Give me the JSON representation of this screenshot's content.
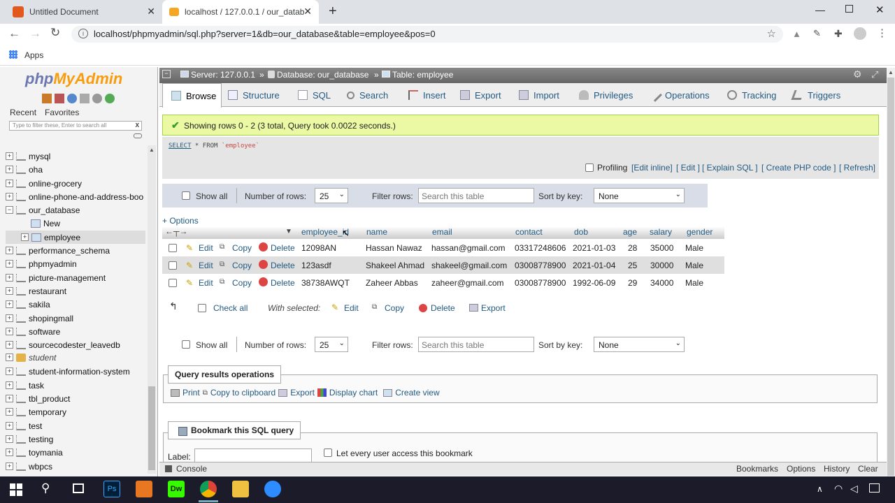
{
  "browser": {
    "tabs": [
      {
        "title": "Untitled Document"
      },
      {
        "title": "localhost / 127.0.0.1 / our_datab"
      }
    ],
    "url": "localhost/phpmyadmin/sql.php?server=1&db=our_database&table=employee&pos=0",
    "bookmarks_apps": "Apps"
  },
  "sidebar": {
    "logo_php": "php",
    "logo_myadmin": "MyAdmin",
    "recent": "Recent",
    "favorites": "Favorites",
    "filter_placeholder": "Type to filter these, Enter to search all",
    "filter_clear": "X",
    "databases": [
      "mysql",
      "oha",
      "online-grocery",
      "online-phone-and-address-boo",
      "our_database",
      "New",
      "employee",
      "performance_schema",
      "phpmyadmin",
      "picture-management",
      "restaurant",
      "sakila",
      "shopingmall",
      "software",
      "sourcecodester_leavedb",
      "student",
      "student-information-system",
      "task",
      "tbl_product",
      "temporary",
      "test",
      "testing",
      "toymania",
      "wbpcs"
    ]
  },
  "breadcrumb": {
    "server": "Server: 127.0.0.1",
    "database": "Database: our_database",
    "table": "Table: employee",
    "sep": "»"
  },
  "menu": [
    "Browse",
    "Structure",
    "SQL",
    "Search",
    "Insert",
    "Export",
    "Import",
    "Privileges",
    "Operations",
    "Tracking",
    "Triggers"
  ],
  "success": "Showing rows 0 - 2 (3 total, Query took 0.0022 seconds.)",
  "sql": {
    "kw": "SELECT",
    "rest": " * FROM ",
    "tbl": "`employee`"
  },
  "profiling": {
    "label": "Profiling",
    "links": [
      "[Edit inline]",
      "[ Edit ]",
      "[ Explain SQL ]",
      "[ Create PHP code ]",
      "[ Refresh]"
    ]
  },
  "controls": {
    "show_all": "Show all",
    "num_rows_label": "Number of rows:",
    "num_rows": "25",
    "filter_label": "Filter rows:",
    "filter_placeholder": "Search this table",
    "sort_label": "Sort by key:",
    "sort_value": "None"
  },
  "options": "+ Options",
  "columns": [
    "employee_id",
    "name",
    "email",
    "contact",
    "dob",
    "age",
    "salary",
    "gender"
  ],
  "row_actions": {
    "edit": "Edit",
    "copy": "Copy",
    "delete": "Delete"
  },
  "rows": [
    [
      "12098AN",
      "Hassan Nawaz",
      "hassan@gmail.com",
      "03317248606",
      "2021-01-03",
      "28",
      "35000",
      "Male"
    ],
    [
      "123asdf",
      "Shakeel Ahmad",
      "shakeel@gmail.com",
      "03008778900",
      "2021-01-04",
      "25",
      "30000",
      "Male"
    ],
    [
      "38738AWQT",
      "Zaheer Abbas",
      "zaheer@gmail.com",
      "03008778900",
      "1992-06-09",
      "29",
      "34000",
      "Male"
    ]
  ],
  "with_selected": {
    "check_all": "Check all",
    "label": "With selected:",
    "edit": "Edit",
    "copy": "Copy",
    "delete": "Delete",
    "export": "Export"
  },
  "qro": {
    "legend": "Query results operations",
    "print": "Print",
    "copy_clip": "Copy to clipboard",
    "export": "Export",
    "chart": "Display chart",
    "view": "Create view"
  },
  "bookmark": {
    "legend": "Bookmark this SQL query",
    "label": "Label:",
    "every_user": "Let every user access this bookmark"
  },
  "console": {
    "label": "Console",
    "links": [
      "Bookmarks",
      "Options",
      "History",
      "Clear"
    ]
  }
}
